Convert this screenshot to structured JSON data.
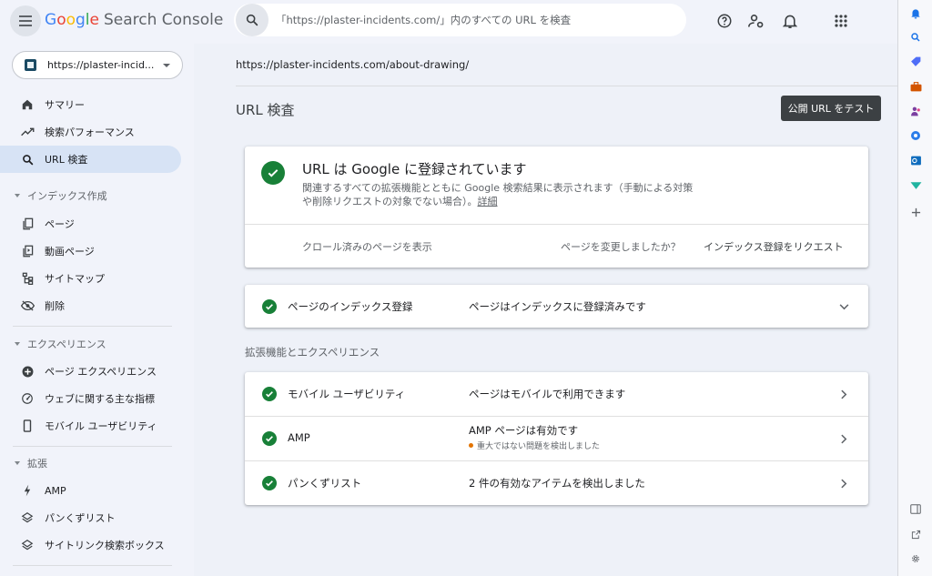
{
  "app": {
    "logo_letters": [
      "G",
      "o",
      "o",
      "g",
      "l",
      "e"
    ],
    "product": "Search Console",
    "search_placeholder": "「https://plaster-incidents.com/」内のすべての URL を検査"
  },
  "header_icons": [
    "help-icon",
    "manage-users-icon",
    "notifications-icon",
    "apps-grid-icon"
  ],
  "sidebar": {
    "property": "https://plaster-incid...",
    "items": [
      {
        "label": "サマリー",
        "icon": "home-icon"
      },
      {
        "label": "検索パフォーマンス",
        "icon": "trending-up-icon"
      },
      {
        "label": "URL 検査",
        "icon": "search-icon",
        "active": true
      }
    ],
    "sections": [
      {
        "title": "インデックス作成",
        "items": [
          {
            "label": "ページ",
            "icon": "pages-icon"
          },
          {
            "label": "動画ページ",
            "icon": "video-pages-icon"
          },
          {
            "label": "サイトマップ",
            "icon": "sitemap-icon"
          },
          {
            "label": "削除",
            "icon": "removals-icon"
          }
        ]
      },
      {
        "title": "エクスペリエンス",
        "items": [
          {
            "label": "ページ エクスペリエンス",
            "icon": "add-circle-icon"
          },
          {
            "label": "ウェブに関する主な指標",
            "icon": "speed-icon"
          },
          {
            "label": "モバイル ユーザビリティ",
            "icon": "smartphone-icon"
          }
        ]
      },
      {
        "title": "拡張",
        "items": [
          {
            "label": "AMP",
            "icon": "bolt-icon"
          },
          {
            "label": "パンくずリスト",
            "icon": "layers-icon"
          },
          {
            "label": "サイトリンク検索ボックス",
            "icon": "layers-icon"
          }
        ]
      }
    ]
  },
  "main": {
    "inspected_url": "https://plaster-incidents.com/about-drawing/",
    "title": "URL 検査",
    "test_button": "公開 URL をテスト",
    "status": {
      "title": "URL は Google に登録されています",
      "description": "関連するすべての拡張機能とともに Google 検索結果に表示されます（手動による対策や削除リクエストの対象でない場合）。",
      "details_link": "詳細",
      "view_crawled": "クロール済みのページを表示",
      "changed_question": "ページを変更しましたか？",
      "request_indexing": "インデックス登録をリクエスト"
    },
    "indexing_row": {
      "label": "ページのインデックス登録",
      "value": "ページはインデックスに登録済みです"
    },
    "enhancements_title": "拡張機能とエクスペリエンス",
    "enhancements": [
      {
        "label": "モバイル ユーザビリティ",
        "value": "ページはモバイルで利用できます"
      },
      {
        "label": "AMP",
        "value": "AMP ページは有効です",
        "sub": "重大ではない問題を検出しました"
      },
      {
        "label": "パンくずリスト",
        "value": "2 件の有効なアイテムを検出しました"
      }
    ]
  },
  "colors": {
    "success": "#188038",
    "warning": "#e37400",
    "active_nav": "#d7e3f5",
    "button_dark": "#3c4043"
  }
}
